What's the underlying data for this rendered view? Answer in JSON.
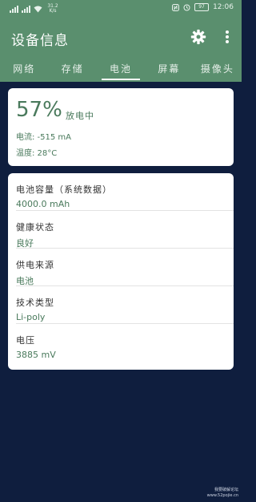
{
  "status_bar": {
    "network_speed": "31.2 K/s",
    "battery_level": "97",
    "time": "12:06"
  },
  "app_bar": {
    "title": "设备信息",
    "settings_icon": "gear-icon",
    "more_icon": "more-vert-icon"
  },
  "tabs": [
    "网络",
    "存储",
    "电池",
    "屏幕",
    "摄像头"
  ],
  "active_tab": 2,
  "battery_summary": {
    "percent": "57%",
    "charge_status": "放电中",
    "current": "电流: -515 mA",
    "temperature": "温度: 28°C"
  },
  "details": [
    {
      "label": "电池容量（系统数据）",
      "value": "4000.0 mAh"
    },
    {
      "label": "健康状态",
      "value": "良好"
    },
    {
      "label": "供电来源",
      "value": "电池"
    },
    {
      "label": "技术类型",
      "value": "Li-poly"
    },
    {
      "label": "电压",
      "value": "3885 mV"
    }
  ],
  "watermark": {
    "line1": "我要破解论坛",
    "line2": "www.52pojie.cn"
  },
  "colors": {
    "app_bar": "#5a8f6e",
    "background": "#0f1e3e",
    "accent_text": "#4a7a5c"
  }
}
